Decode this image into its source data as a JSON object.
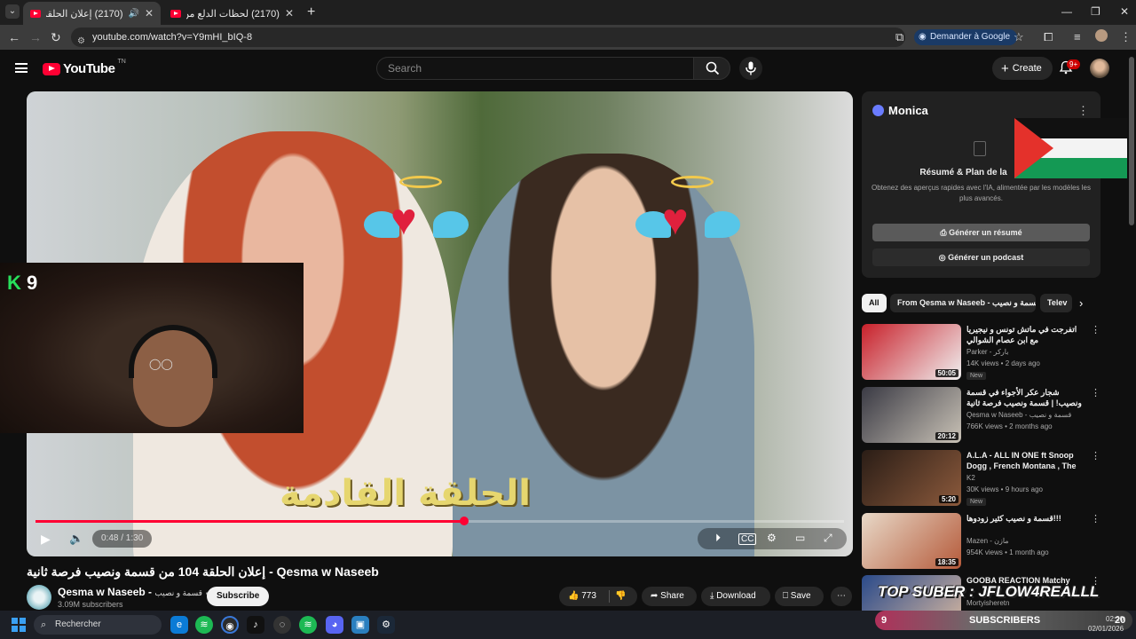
{
  "browser": {
    "tabs": [
      {
        "title": "(2170) إعلان الحلقة 104 من قسمة...",
        "active": true
      },
      {
        "title": "(2170) لحظات الدلع من خلود | ال...",
        "active": false
      }
    ],
    "url": "youtube.com/watch?v=Y9mHI_bIQ-8",
    "google_button": "Demander à Google"
  },
  "header": {
    "logo_text": "YouTube",
    "logo_sup": "TN",
    "search_placeholder": "Search",
    "create_label": "Create",
    "notif_count": "9+"
  },
  "player": {
    "overlay_caption": "الحلقة القادمة",
    "time": "0:48 / 1:30",
    "progress": 0.53,
    "webcam_label_k": "K",
    "webcam_label_num": "9"
  },
  "video": {
    "title": "إعلان الحلقة 104 من قسمة ونصيب فرصة ثانية - Qesma w Naseeb",
    "channel_name": "Qesma w Naseeb - ",
    "channel_name_ar": "قسمة و نصيب",
    "subscribers": "3.09M subscribers",
    "subscribe_label": "Subscribe",
    "likes": "773",
    "share_label": "Share",
    "download_label": "Download",
    "save_label": "Save"
  },
  "monica": {
    "name": "Monica",
    "heading": "Résumé & Plan de la",
    "description": "Obtenez des aperçus rapides avec l'IA, alimentée par les modèles les plus avancés.",
    "btn_summary": "Générer un résumé",
    "btn_podcast": "Générer un podcast"
  },
  "chips": [
    "All",
    "From Qesma w Naseeb - قسمة و نصيب",
    "Telev"
  ],
  "recommendations": [
    {
      "title": "اتفرجت في ماتش تونس و نيجيريا مع ابن عصام الشوالي",
      "channel": "Parker - باركر",
      "meta": "14K views • 2 days ago",
      "badge": "New",
      "duration": "50:05",
      "colors": [
        "#c8202a",
        "#f0f0f0"
      ]
    },
    {
      "title": "شجار عكر الأجواء في قسمة ونصيب! | قسمة ونصيب فرصة ثانية الحلقة 51 - Qesma",
      "channel": "Qesma w Naseeb - قسمة و نصيب",
      "meta": "766K views • 2 months ago",
      "badge": "",
      "duration": "20:12",
      "colors": [
        "#3a3a44",
        "#c9c2b6"
      ]
    },
    {
      "title": "A.L.A - ALL IN ONE ft Snoop Dogg , French Montana , The ...",
      "channel": "K2",
      "meta": "30K views • 9 hours ago",
      "badge": "New",
      "duration": "5:20",
      "colors": [
        "#2a1d16",
        "#8c5a3c"
      ]
    },
    {
      "title": "قسمة و نصيب كثير زودوها!!!",
      "channel": "Mazen - مازن",
      "meta": "954K views • 1 month ago",
      "badge": "",
      "duration": "18:35",
      "colors": [
        "#e8d9c8",
        "#b55a3a"
      ]
    },
    {
      "title": "GOOBA REACTION Matchy",
      "channel": "Mortyisheretn",
      "meta": "",
      "badge": "",
      "duration": "",
      "colors": [
        "#2a4a8a",
        "#d8b8a0"
      ]
    }
  ],
  "stream_overlay": {
    "banner": "TOP SUBER : JFLOW4REALLL",
    "count": "9",
    "label": "SUBSCRIBERS",
    "goal": "20"
  },
  "taskbar": {
    "search_label": "Rechercher",
    "time": "02:20",
    "date": "02/01/2026"
  }
}
